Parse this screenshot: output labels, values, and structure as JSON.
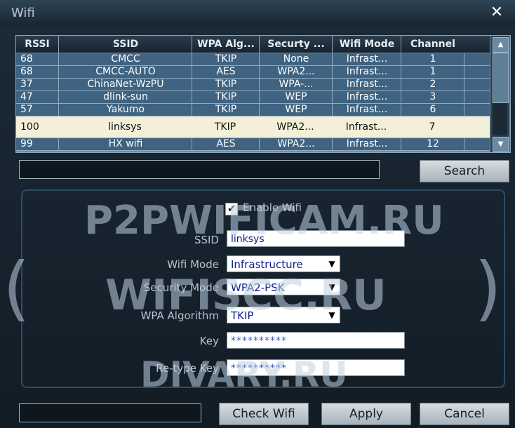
{
  "window": {
    "title": "Wifi",
    "close_icon": "close-icon"
  },
  "table": {
    "columns": [
      "RSSI",
      "SSID",
      "WPA Alg...",
      "Securty ...",
      "Wifi Mode",
      "Channel"
    ],
    "rows": [
      [
        "68",
        "CMCC",
        "TKIP",
        "None",
        "Infrast...",
        "1"
      ],
      [
        "68",
        "CMCC-AUTO",
        "AES",
        "WPA2...",
        "Infrast...",
        "1"
      ],
      [
        "37",
        "ChinaNet-WzPU",
        "TKIP",
        "WPA-...",
        "Infrast...",
        "2"
      ],
      [
        "47",
        "dlink-sun",
        "TKIP",
        "WEP",
        "Infrast...",
        "3"
      ],
      [
        "57",
        "Yakumo",
        "TKIP",
        "WEP",
        "Infrast...",
        "6"
      ],
      [
        "100",
        "linksys",
        "TKIP",
        "WPA2...",
        "Infrast...",
        "7"
      ],
      [
        "99",
        "HX wifi",
        "AES",
        "WPA2...",
        "Infrast...",
        "12"
      ]
    ],
    "selected_row": 5
  },
  "search": {
    "value": "",
    "button_label": "Search"
  },
  "settings": {
    "enable_wifi_label": "Enable Wifi",
    "enable_wifi_checked": true,
    "ssid_label": "SSID",
    "ssid_value": "linksys",
    "wifi_mode_label": "Wifi Mode",
    "wifi_mode_value": "Infrastructure",
    "security_mode_label": "Security Mode",
    "security_mode_value": "WPA2-PSK",
    "wpa_algorithm_label": "WPA Algorithm",
    "wpa_algorithm_value": "TKIP",
    "key_label": "Key",
    "key_value": "**********",
    "retype_key_label": "Re-type Key",
    "retype_key_value": "**********"
  },
  "buttons": {
    "check_wifi": "Check Wifi",
    "apply": "Apply",
    "cancel": "Cancel"
  },
  "watermarks": {
    "top": "P2PWIFICAM.RU",
    "middle": "WIFISCC.RU",
    "bottom": "DIVARY.RU",
    "left_paren": "(",
    "right_paren": ")"
  }
}
